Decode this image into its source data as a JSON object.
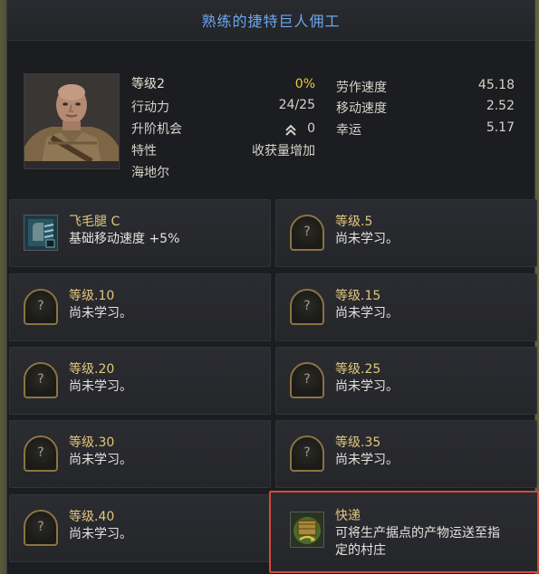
{
  "window": {
    "title": "熟练的捷特巨人佣工"
  },
  "stats": {
    "level_label": "等级2",
    "level_progress": "0%",
    "stamina_label": "行动力",
    "stamina_value": "24/25",
    "promotion_label": "升阶机会",
    "promotion_value": "0",
    "trait_label": "特性",
    "trait_value": "收获量增加",
    "name": "海地尔",
    "work_speed_label": "劳作速度",
    "work_speed_value": "45.18",
    "move_speed_label": "移动速度",
    "move_speed_value": "2.52",
    "luck_label": "幸运",
    "luck_value": "5.17"
  },
  "skills": [
    {
      "title": "飞毛腿 C",
      "desc": "基础移动速度 +5%",
      "learned": true
    },
    {
      "title": "等级.5",
      "desc": "尚未学习。",
      "learned": false
    },
    {
      "title": "等级.10",
      "desc": "尚未学习。",
      "learned": false
    },
    {
      "title": "等级.15",
      "desc": "尚未学习。",
      "learned": false
    },
    {
      "title": "等级.20",
      "desc": "尚未学习。",
      "learned": false
    },
    {
      "title": "等级.25",
      "desc": "尚未学习。",
      "learned": false
    },
    {
      "title": "等级.30",
      "desc": "尚未学习。",
      "learned": false
    },
    {
      "title": "等级.35",
      "desc": "尚未学习。",
      "learned": false
    },
    {
      "title": "等级.40",
      "desc": "尚未学习。",
      "learned": false
    },
    {
      "title": "快递",
      "desc_line1": "可将生产据点的产物运送至指",
      "desc_line2": "定的村庄",
      "learned": true,
      "highlighted": true
    }
  ],
  "slot_glyph": "?",
  "colors": {
    "title": "#6aa7f0",
    "progress": "#f2c63a",
    "skill_title": "#e2c77e",
    "highlight_border": "#d44a3a"
  }
}
